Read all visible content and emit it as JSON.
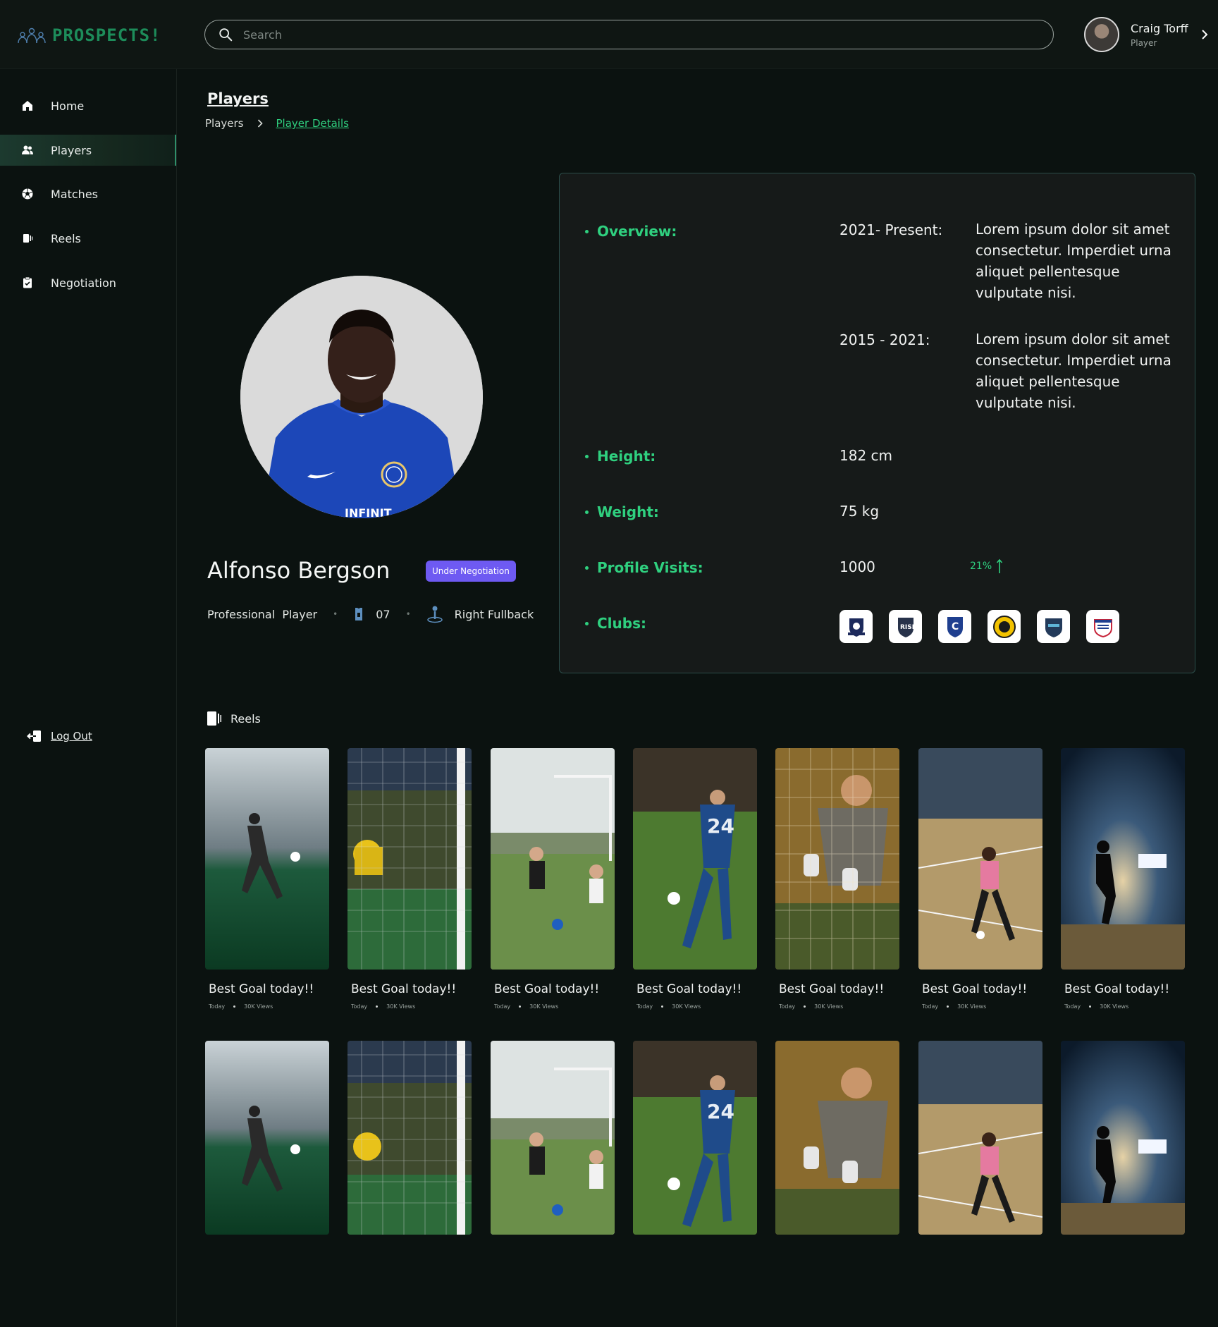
{
  "app": {
    "logo_text": "PROSPECTS!"
  },
  "search": {
    "placeholder": "Search"
  },
  "user": {
    "name": "Craig Torff",
    "role": "Player"
  },
  "sidebar": {
    "items": [
      {
        "label": "Home",
        "icon": "home-icon"
      },
      {
        "label": "Players",
        "icon": "users-icon",
        "active": true
      },
      {
        "label": "Matches",
        "icon": "soccer-ball-icon"
      },
      {
        "label": "Reels",
        "icon": "reels-icon"
      },
      {
        "label": "Negotiation",
        "icon": "clipboard-icon"
      }
    ],
    "logout_label": "Log Out"
  },
  "page": {
    "title": "Players",
    "breadcrumb": {
      "root": "Players",
      "current": "Player Details"
    }
  },
  "player": {
    "name": "Alfonso Bergson",
    "status": "Under Negotiation",
    "type": "Professional  Player",
    "number": "07",
    "position": "Right Fullback"
  },
  "details": {
    "overview_label": "Overview:",
    "overview": [
      {
        "period": "2021- Present:",
        "text": "Lorem ipsum dolor sit amet consectetur. Imperdiet urna aliquet pellentesque vulputate nisi."
      },
      {
        "period": "2015 - 2021:",
        "text": "Lorem ipsum dolor sit amet consectetur. Imperdiet urna aliquet pellentesque vulputate nisi."
      }
    ],
    "height_label": "Height:",
    "height": "182 cm",
    "weight_label": "Weight:",
    "weight": "75 kg",
    "visits_label": "Profile Visits:",
    "visits": "1000",
    "visits_growth": "21%",
    "clubs_label": "Clubs:",
    "clubs": [
      "club-crest-1",
      "club-crest-2",
      "club-crest-3",
      "club-crest-4",
      "club-crest-5",
      "club-crest-6"
    ]
  },
  "reels": {
    "heading": "Reels",
    "items": [
      {
        "title": "Best Goal today!!",
        "date": "Today",
        "views": "30K Views"
      },
      {
        "title": "Best Goal today!!",
        "date": "Today",
        "views": "30K Views"
      },
      {
        "title": "Best Goal today!!",
        "date": "Today",
        "views": "30K Views"
      },
      {
        "title": "Best Goal today!!",
        "date": "Today",
        "views": "30K Views"
      },
      {
        "title": "Best Goal today!!",
        "date": "Today",
        "views": "30K Views"
      },
      {
        "title": "Best Goal today!!",
        "date": "Today",
        "views": "30K Views"
      },
      {
        "title": "Best Goal today!!",
        "date": "Today",
        "views": "30K Views"
      }
    ]
  },
  "colors": {
    "background": "#0b1210",
    "accent": "#2fd07f",
    "badge": "#6e5af2",
    "card_border": "#2b4d4a"
  }
}
